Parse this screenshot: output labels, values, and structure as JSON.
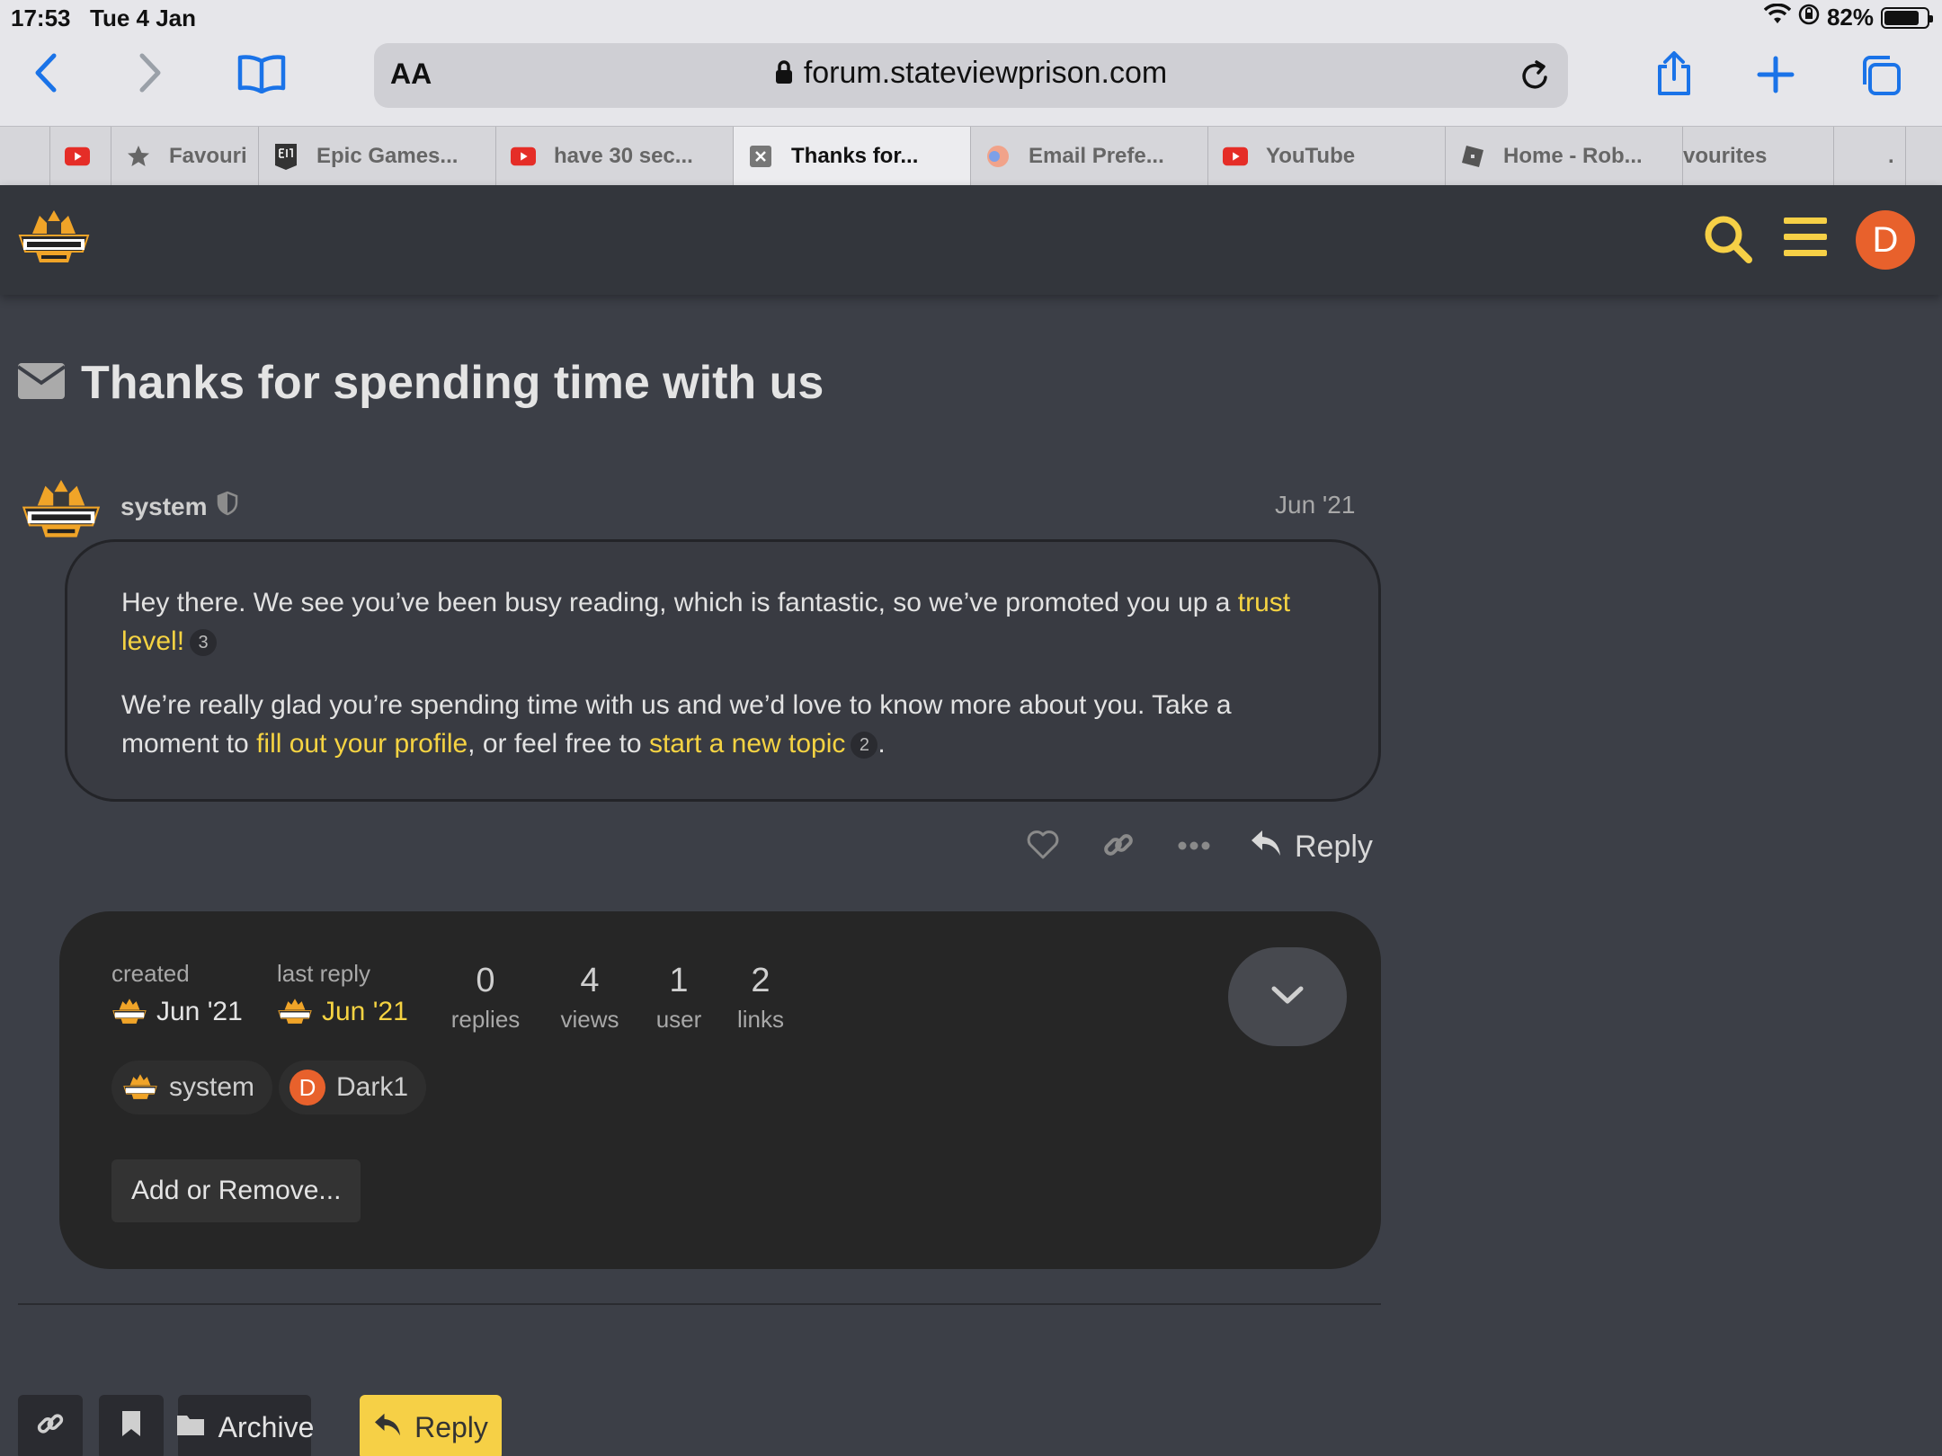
{
  "status_bar": {
    "time": "17:53",
    "date": "Tue 4 Jan",
    "battery": "82%",
    "battery_level": 0.82
  },
  "browser": {
    "address_aa": "AA",
    "url": "forum.stateviewprison.com",
    "tabs": [
      {
        "label": "",
        "icon": "youtube-icon"
      },
      {
        "label": "Favouri",
        "icon": "star-icon"
      },
      {
        "label": "Epic Games...",
        "icon": "epic-games-icon"
      },
      {
        "label": "have 30 sec...",
        "icon": "youtube-icon"
      },
      {
        "label": "Thanks for...",
        "icon": "close-tab-icon",
        "active": true
      },
      {
        "label": "Email Prefe...",
        "icon": "site-icon"
      },
      {
        "label": "YouTube",
        "icon": "youtube-icon"
      },
      {
        "label": "Home - Rob...",
        "icon": "roblox-icon"
      },
      {
        "label": "vourites",
        "icon": ""
      },
      {
        "label": ".",
        "icon": ""
      }
    ]
  },
  "header": {
    "avatar_letter": "D"
  },
  "topic": {
    "title": "Thanks for spending time with us",
    "post": {
      "author": "system",
      "date": "Jun '21",
      "p1_text": "Hey there. We see you’ve been busy reading, which is fantastic, so we’ve promoted you up a ",
      "p1_link": "trust level!",
      "p1_count": "3",
      "p2_text1": "We’re really glad you’re spending time with us and we’d love to know more about you. Take a moment to ",
      "p2_link1": "fill out your profile",
      "p2_text2": ", or feel free to ",
      "p2_link2": "start a new topic",
      "p2_count": "2",
      "p2_end": "."
    },
    "actions": {
      "reply": "Reply"
    }
  },
  "topic_map": {
    "created_label": "created",
    "created_date": "Jun '21",
    "last_reply_label": "last reply",
    "last_reply_date": "Jun '21",
    "stats": [
      {
        "num": "0",
        "label": "replies"
      },
      {
        "num": "4",
        "label": "views"
      },
      {
        "num": "1",
        "label": "user"
      },
      {
        "num": "2",
        "label": "links"
      }
    ],
    "participants": [
      {
        "name": "system"
      },
      {
        "name": "Dark1",
        "letter": "D"
      }
    ],
    "add_remove": "Add or Remove..."
  },
  "footer": {
    "archive": "Archive",
    "reply": "Reply"
  },
  "colors": {
    "accent": "#f6d046",
    "avatar": "#e8612c",
    "ios_blue": "#1a73e8"
  }
}
